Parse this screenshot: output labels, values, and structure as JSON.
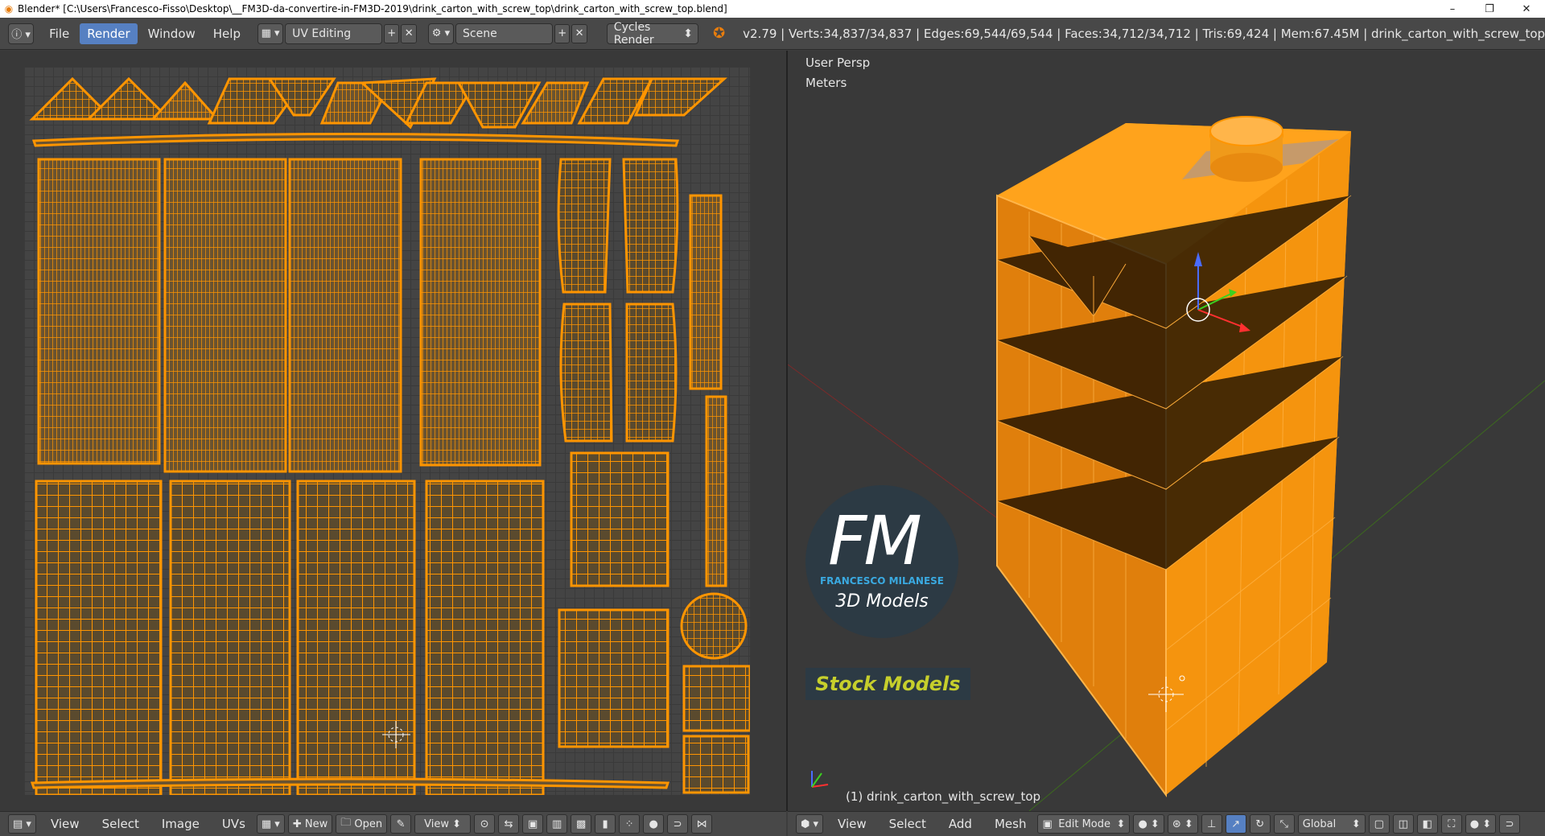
{
  "window": {
    "title": "Blender* [C:\\Users\\Francesco-Fisso\\Desktop\\__FM3D-da-convertire-in-FM3D-2019\\drink_carton_with_screw_top\\drink_carton_with_screw_top.blend]",
    "minimize": "–",
    "restore": "❐",
    "close": "✕"
  },
  "topbar": {
    "menus": [
      "File",
      "Render",
      "Window",
      "Help"
    ],
    "active_menu": "Render",
    "layout": "UV Editing",
    "scene": "Scene",
    "engine": "Cycles Render",
    "stats": "v2.79 | Verts:34,837/34,837 | Edges:69,544/69,544 | Faces:34,712/34,712 | Tris:69,424 | Mem:67.45M | drink_carton_with_screw_top"
  },
  "viewport": {
    "view_name": "User Persp",
    "units": "Meters",
    "object_label": "(1) drink_carton_with_screw_top",
    "watermark": {
      "initials": "FM",
      "name": "FRANCESCO MILANESE",
      "sub": "3D Models",
      "badge": "Stock Models"
    }
  },
  "uv_bottombar": {
    "items": [
      "View",
      "Select",
      "Image",
      "UVs"
    ],
    "new": "New",
    "open": "Open",
    "view": "View"
  },
  "vp_bottombar": {
    "items": [
      "View",
      "Select",
      "Add",
      "Mesh"
    ],
    "mode": "Edit Mode",
    "orientation": "Global"
  },
  "colors": {
    "accent": "#ff9500",
    "active_menu": "#5680c2",
    "badge_text": "#c6cf2c",
    "logo_blue": "#3aa9e0"
  }
}
